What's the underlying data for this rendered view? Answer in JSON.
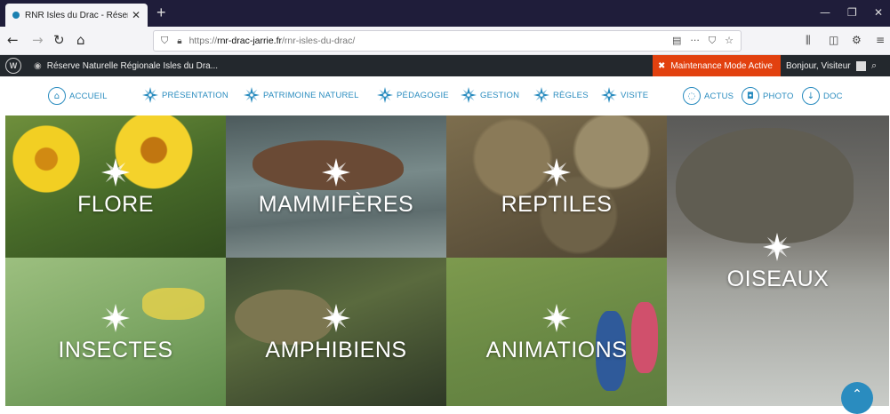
{
  "browser": {
    "tab_title": "RNR Isles du Drac - Réserve Na",
    "tab_close": "✕",
    "new_tab": "+",
    "url_protocol": "https://",
    "url_host": "rnr-drac-jarrie.fr",
    "url_path": "/rnr-isles-du-drac/",
    "win_min": "—",
    "win_max": "❐",
    "win_close": "✕"
  },
  "adminbar": {
    "site_name": "Réserve Naturelle Régionale Isles du Dra...",
    "maintenance": "Maintenance Mode Active",
    "greeting": "Bonjour, Visiteur"
  },
  "nav": {
    "accueil": "ACCUEIL",
    "presentation": "PRÉSENTATION",
    "patrimoine": "PATRIMOINE NATUREL",
    "pedagogie": "PÉDAGOGIE",
    "gestion": "GESTION",
    "regles": "RÈGLES",
    "visite": "VISITE",
    "actus": "ACTUS",
    "photo": "PHOTO",
    "doc": "DOC"
  },
  "tiles": {
    "flore": "FLORE",
    "mammiferes": "MAMMIFÈRES",
    "reptiles": "REPTILES",
    "oiseaux": "OISEAUX",
    "insectes": "INSECTES",
    "amphibiens": "AMPHIBIENS",
    "animations": "ANIMATIONS"
  },
  "colors": {
    "accent": "#2a8cbf",
    "maintenance": "#e2410f",
    "adminbar": "#23282d",
    "tabbar": "#1f1d3a"
  }
}
